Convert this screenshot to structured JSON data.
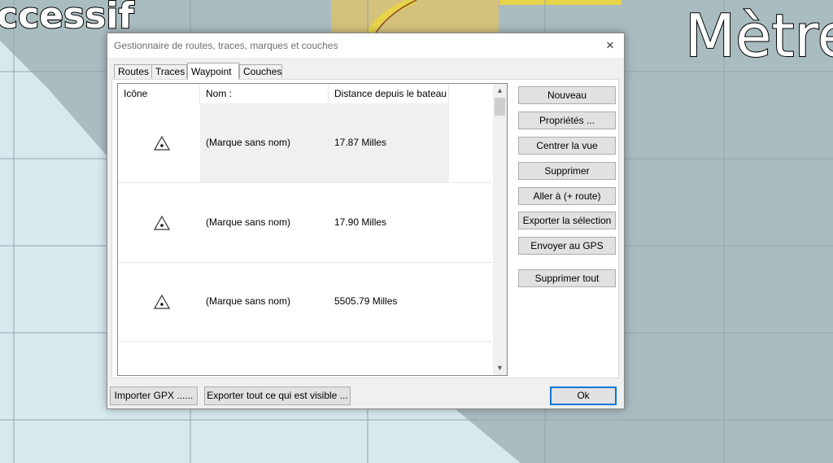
{
  "map": {
    "label_left": "ccessif",
    "label_right": "Mètre",
    "colors": {
      "water": "#d6eaee",
      "shoal": "#a9bcc0",
      "grid": "#8ea7ad",
      "land": "#d3c17c"
    }
  },
  "dialog": {
    "title": "Gestionnaire de routes, traces, marques et couches",
    "close_icon": "×",
    "tabs": [
      {
        "label": "Routes"
      },
      {
        "label": "Traces"
      },
      {
        "label": "Waypoint"
      },
      {
        "label": "Couches"
      }
    ],
    "active_tab": "Waypoint",
    "columns": [
      "Icône",
      "Nom :",
      "Distance depuis le bateau"
    ],
    "rows": [
      {
        "icon": "waypoint-triangle-icon",
        "name": "(Marque sans nom)",
        "distance": "17.87 Milles"
      },
      {
        "icon": "waypoint-triangle-icon",
        "name": "(Marque sans nom)",
        "distance": "17.90 Milles"
      },
      {
        "icon": "waypoint-triangle-icon",
        "name": "(Marque sans nom)",
        "distance": "5505.79 Milles"
      }
    ],
    "buttons": {
      "new": "Nouveau",
      "properties": "Propriétés ...",
      "center": "Centrer la vue",
      "delete": "Supprimer",
      "goto": "Aller à (+ route)",
      "export_selection": "Exporter la sélection",
      "send_gps": "Envoyer au GPS",
      "delete_all": "Supprimer tout",
      "import_gpx": "Importer GPX ......",
      "export_visible": "Exporter tout ce qui est visible ...",
      "ok": "Ok"
    }
  }
}
